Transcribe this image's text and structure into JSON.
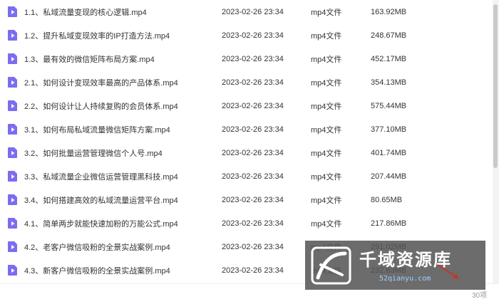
{
  "files": [
    {
      "name": "1.1、私域流量变现的核心逻辑.mp4",
      "date": "2023-02-26 23:34",
      "type": "mp4文件",
      "size": "163.92MB"
    },
    {
      "name": "1.2、提升私域变现效率的IP打造方法.mp4",
      "date": "2023-02-26 23:34",
      "type": "mp4文件",
      "size": "248.67MB"
    },
    {
      "name": "1.3、最有效的微信矩阵布局方案.mp4",
      "date": "2023-02-26 23:34",
      "type": "mp4文件",
      "size": "452.17MB"
    },
    {
      "name": "2.1、如何设计变现效率最高的产品体系.mp4",
      "date": "2023-02-26 23:34",
      "type": "mp4文件",
      "size": "354.13MB"
    },
    {
      "name": "2.2、如何设计让人持续复购的会员体系.mp4",
      "date": "2023-02-26 23:34",
      "type": "mp4文件",
      "size": "575.44MB"
    },
    {
      "name": "3.1、如何布局私域流量微信矩阵方案.mp4",
      "date": "2023-02-26 23:34",
      "type": "mp4文件",
      "size": "377.10MB"
    },
    {
      "name": "3.2、如何批量运营管理微信个人号.mp4",
      "date": "2023-02-26 23:34",
      "type": "mp4文件",
      "size": "401.74MB"
    },
    {
      "name": "3.3、私域流量企业微信运营管理黑科技.mp4",
      "date": "2023-02-26 23:34",
      "type": "mp4文件",
      "size": "207.44MB"
    },
    {
      "name": "3.4、如何搭建高效的私域流量运营平台.mp4",
      "date": "2023-02-26 23:34",
      "type": "mp4文件",
      "size": "80.65MB"
    },
    {
      "name": "4.1、简单两步就能快速加粉的万能公式.mp4",
      "date": "2023-02-26 23:34",
      "type": "mp4文件",
      "size": "217.86MB"
    },
    {
      "name": "4.2、老客户微信吸粉的全景实战案例.mp4",
      "date": "2023-02-26 23:34",
      "type": "mp4文件",
      "size": "291.02MB"
    },
    {
      "name": "4.3、新客户微信吸粉的全景实战案例.mp4",
      "date": "2023-02-26 23:34",
      "type": "mp4文件",
      "size": "232.63MB"
    }
  ],
  "footer": {
    "count": "30项"
  },
  "watermark": {
    "title": "千域资源库",
    "url": "52qianyu.com"
  },
  "colors": {
    "file_icon": "#7b6cf0",
    "watermark_bg": "#545454",
    "url": "#9fd0ff"
  }
}
